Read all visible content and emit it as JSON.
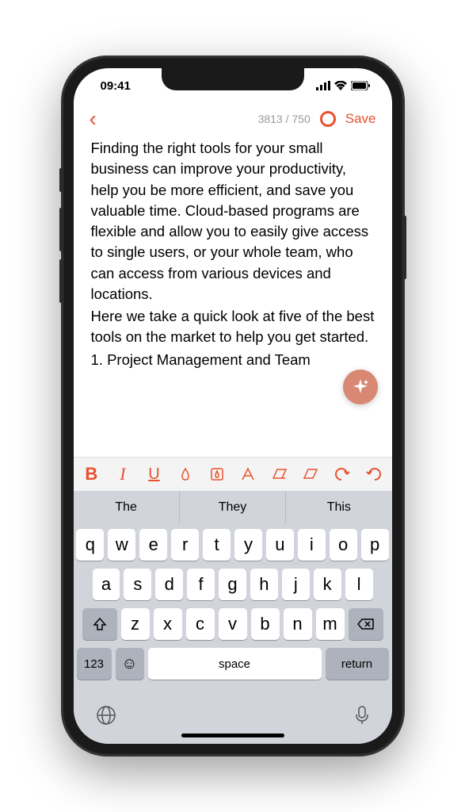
{
  "status": {
    "time": "09:41"
  },
  "nav": {
    "counter": "3813 / 750",
    "save": "Save"
  },
  "doc": {
    "p1": "Finding the right tools for your small business can improve your productivity, help you be more efficient, and save you valuable time. Cloud-based programs are flexible and allow you to easily give access to single users, or your whole team, who can access from various devices and locations.",
    "p2": "Here we take a quick look at five of the best tools on the market to help you get started.",
    "p3": "1. Project Management and Team"
  },
  "suggestions": [
    "The",
    "They",
    "This"
  ],
  "keyboard": {
    "row1": [
      "q",
      "w",
      "e",
      "r",
      "t",
      "y",
      "u",
      "i",
      "o",
      "p"
    ],
    "row2": [
      "a",
      "s",
      "d",
      "f",
      "g",
      "h",
      "j",
      "k",
      "l"
    ],
    "row3": [
      "z",
      "x",
      "c",
      "v",
      "b",
      "n",
      "m"
    ],
    "numkey": "123",
    "space": "space",
    "return": "return"
  }
}
